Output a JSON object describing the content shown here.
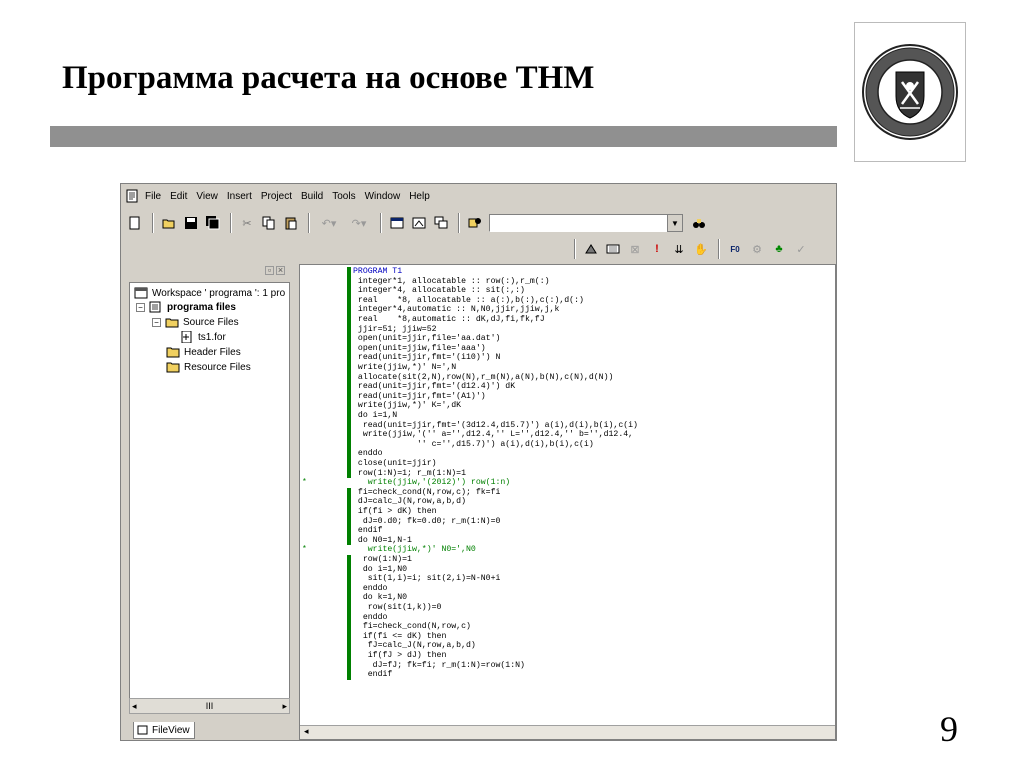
{
  "slide": {
    "title": "Программа расчета на основе ТНМ",
    "page_number": "9"
  },
  "ide": {
    "menu": [
      "File",
      "Edit",
      "View",
      "Insert",
      "Project",
      "Build",
      "Tools",
      "Window",
      "Help"
    ],
    "workspace": {
      "root": "Workspace ' programa ': 1 pro",
      "project": "programa files",
      "folders": [
        "Source Files",
        "Header Files",
        "Resource Files"
      ],
      "file": "ts1.for",
      "tab": "FileView"
    },
    "code_lines": [
      {
        "t": "PROGRAM T1",
        "cls": "kw"
      },
      {
        "t": " integer*1, allocatable :: row(:),r_m(:)",
        "cls": ""
      },
      {
        "t": " integer*4, allocatable :: sit(:,:)",
        "cls": ""
      },
      {
        "t": " real    *8, allocatable :: a(:),b(:),c(:),d(:)",
        "cls": ""
      },
      {
        "t": " integer*4,automatic :: N,N0,jjir,jjiw,j,k",
        "cls": ""
      },
      {
        "t": " real    *8,automatic :: dK,dJ,fi,fk,fJ",
        "cls": ""
      },
      {
        "t": " jjir=51; jjiw=52",
        "cls": ""
      },
      {
        "t": " open(unit=jjir,file='aa.dat')",
        "cls": ""
      },
      {
        "t": " open(unit=jjiw,file='aaa')",
        "cls": ""
      },
      {
        "t": " read(unit=jjir,fmt='(i10)') N",
        "cls": ""
      },
      {
        "t": " write(jjiw,*)' N=',N",
        "cls": ""
      },
      {
        "t": " allocate(sit(2,N),row(N),r_m(N),a(N),b(N),c(N),d(N))",
        "cls": ""
      },
      {
        "t": " read(unit=jjir,fmt='(d12.4)') dK",
        "cls": ""
      },
      {
        "t": " read(unit=jjir,fmt='(A1)')",
        "cls": ""
      },
      {
        "t": " write(jjiw,*)' K=',dK",
        "cls": ""
      },
      {
        "t": " do i=1,N",
        "cls": ""
      },
      {
        "t": "  read(unit=jjir,fmt='(3d12.4,d15.7)') a(i),d(i),b(i),c(i)",
        "cls": ""
      },
      {
        "t": "  write(jjiw,'('' a='',d12.4,'' L='',d12.4,'' b='',d12.4,",
        "cls": ""
      },
      {
        "t": "             '' c='',d15.7)') a(i),d(i),b(i),c(i)",
        "cls": ""
      },
      {
        "t": " enddo",
        "cls": ""
      },
      {
        "t": " close(unit=jjir)",
        "cls": ""
      },
      {
        "t": " row(1:N)=1; r_m(1:N)=1",
        "cls": ""
      },
      {
        "t": "   write(jjiw,'(20i2)') row(1:n)",
        "cls": "cm"
      },
      {
        "t": " fi=check_cond(N,row,c); fk=fi",
        "cls": ""
      },
      {
        "t": " dJ=calc_J(N,row,a,b,d)",
        "cls": ""
      },
      {
        "t": " if(fi > dK) then",
        "cls": ""
      },
      {
        "t": "  dJ=0.d0; fk=0.d0; r_m(1:N)=0",
        "cls": ""
      },
      {
        "t": " endif",
        "cls": ""
      },
      {
        "t": " do N0=1,N-1",
        "cls": ""
      },
      {
        "t": "   write(jjiw,*)' N0=',N0",
        "cls": "cm"
      },
      {
        "t": "  row(1:N)=1",
        "cls": ""
      },
      {
        "t": "  do i=1,N0",
        "cls": ""
      },
      {
        "t": "   sit(1,i)=i; sit(2,i)=N-N0+i",
        "cls": ""
      },
      {
        "t": "  enddo",
        "cls": ""
      },
      {
        "t": "  do k=1,N0",
        "cls": ""
      },
      {
        "t": "   row(sit(1,k))=0",
        "cls": ""
      },
      {
        "t": "  enddo",
        "cls": ""
      },
      {
        "t": "  fi=check_cond(N,row,c)",
        "cls": ""
      },
      {
        "t": "  if(fi <= dK) then",
        "cls": ""
      },
      {
        "t": "   fJ=calc_J(N,row,a,b,d)",
        "cls": ""
      },
      {
        "t": "   if(fJ > dJ) then",
        "cls": ""
      },
      {
        "t": "    dJ=fJ; fk=fi; r_m(1:N)=row(1:N)",
        "cls": ""
      },
      {
        "t": "   endif",
        "cls": ""
      }
    ]
  }
}
